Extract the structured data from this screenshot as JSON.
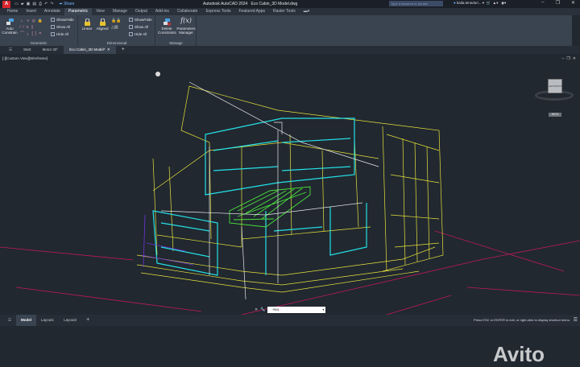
{
  "titlebar": {
    "app_title": "Autodesk AutoCAD 2024",
    "file_name": "Eco Cabin_3D Model.dwg",
    "share_label": "Share",
    "search_placeholder": "Type a keyword or phrase",
    "user": "kaila.tenedori...",
    "logo": "A"
  },
  "menu_tabs": [
    "Home",
    "Insert",
    "Annotate",
    "Parametric",
    "View",
    "Manage",
    "Output",
    "Add-ins",
    "Collaborate",
    "Express Tools",
    "Featured Apps",
    "Raster Tools"
  ],
  "ribbon": {
    "geometric": {
      "label": "Geometric",
      "auto_constrain": "Auto Constrain",
      "show_hide": "Show/Hide",
      "show_all": "Show All",
      "hide_all": "Hide All"
    },
    "dimensional": {
      "label": "Dimensional",
      "linear": "Linear",
      "aligned": "Aligned",
      "show_hide": "Show/Hide",
      "show_all": "Show All",
      "hide_all": "Hide All"
    },
    "manage": {
      "label": "Manage",
      "delete_constraints": "Delete Constraints",
      "parameters_manager": "Parameters Manager"
    }
  },
  "doc_tabs": [
    "Start",
    "Motor 30°",
    "Eco Cabin_3D Model*"
  ],
  "viewport": {
    "label": "[-][Custom View][Wireframe]",
    "viewcube_left": "LEFT",
    "viewcube_front": "FRONT",
    "wcs": "WCS"
  },
  "command": {
    "value": "PAN"
  },
  "layout_tabs": [
    "Model",
    "Layout1",
    "Layout2"
  ],
  "status_message": "Press ESC or ENTER to exit, or right-click to display shortcut menu.",
  "watermark": "Avito",
  "colors": {
    "accent": "#d8262e",
    "yellow": "#e6e23a",
    "cyan": "#25e0e6",
    "green": "#49e33a",
    "magenta": "#c0195a"
  }
}
